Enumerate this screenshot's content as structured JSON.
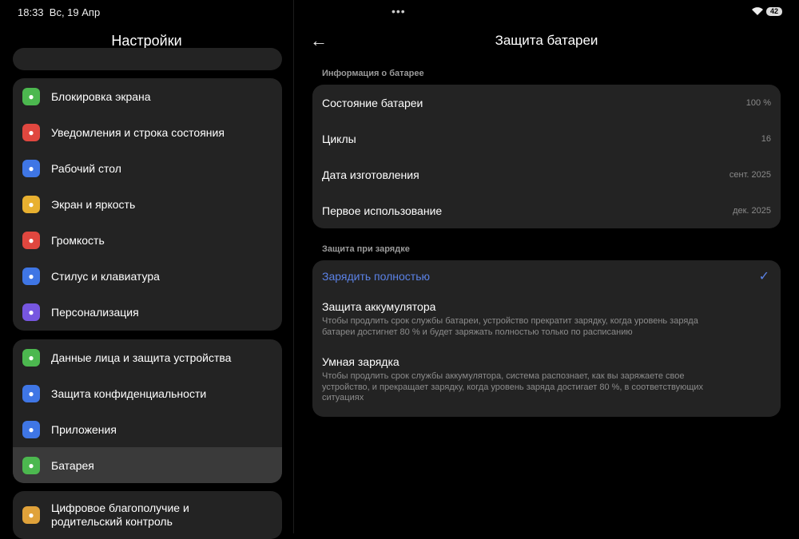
{
  "status_bar": {
    "time": "18:33",
    "date": "Вс, 19 Апр",
    "battery": "42",
    "more": "•••"
  },
  "left": {
    "title": "Настройки",
    "groups": [
      [
        {
          "label": "Блокировка экрана",
          "color": "#4cb84f",
          "icon": "lock-icon"
        },
        {
          "label": "Уведомления и строка состояния",
          "color": "#e0473f",
          "icon": "notification-icon"
        },
        {
          "label": "Рабочий стол",
          "color": "#3f76e5",
          "icon": "home-icon"
        },
        {
          "label": "Экран и яркость",
          "color": "#e8b030",
          "icon": "sun-icon"
        },
        {
          "label": "Громкость",
          "color": "#e0473f",
          "icon": "speaker-icon"
        },
        {
          "label": "Стилус и клавиатура",
          "color": "#3f76e5",
          "icon": "keyboard-icon"
        },
        {
          "label": "Персонализация",
          "color": "#7656e0",
          "icon": "brush-icon"
        }
      ],
      [
        {
          "label": "Данные лица и защита устройства",
          "color": "#4cb84f",
          "icon": "fingerprint-icon"
        },
        {
          "label": "Защита конфиденциальности",
          "color": "#3f76e5",
          "icon": "privacy-icon"
        },
        {
          "label": "Приложения",
          "color": "#3f76e5",
          "icon": "apps-icon"
        },
        {
          "label": "Батарея",
          "color": "#4cb84f",
          "icon": "battery-icon"
        }
      ],
      [
        {
          "label": "Цифровое благополучие и родительский контроль",
          "color": "#e0a23a",
          "icon": "wellbeing-icon"
        }
      ]
    ]
  },
  "right": {
    "title": "Защита батареи",
    "info_section": "Информация о батарее",
    "info": [
      {
        "label": "Состояние батареи",
        "value": "100 %"
      },
      {
        "label": "Циклы",
        "value": "16"
      },
      {
        "label": "Дата изготовления",
        "value": "сент. 2025"
      },
      {
        "label": "Первое использование",
        "value": "дек. 2025"
      }
    ],
    "charge_section": "Защита при зарядке",
    "options": [
      {
        "title": "Зарядить полностью",
        "desc": "",
        "selected": true
      },
      {
        "title": "Защита аккумулятора",
        "desc": "Чтобы продлить срок службы батареи, устройство прекратит зарядку, когда уровень заряда батареи достигнет 80 % и будет заряжать полностью только по расписанию"
      },
      {
        "title": "Умная зарядка",
        "desc": "Чтобы продлить срок службы аккумулятора, система распознает, как вы заряжаете свое устройство, и прекращает зарядку, когда уровень заряда достигает 80 %, в соответствующих ситуациях"
      }
    ],
    "accent": "#5b82e6"
  }
}
